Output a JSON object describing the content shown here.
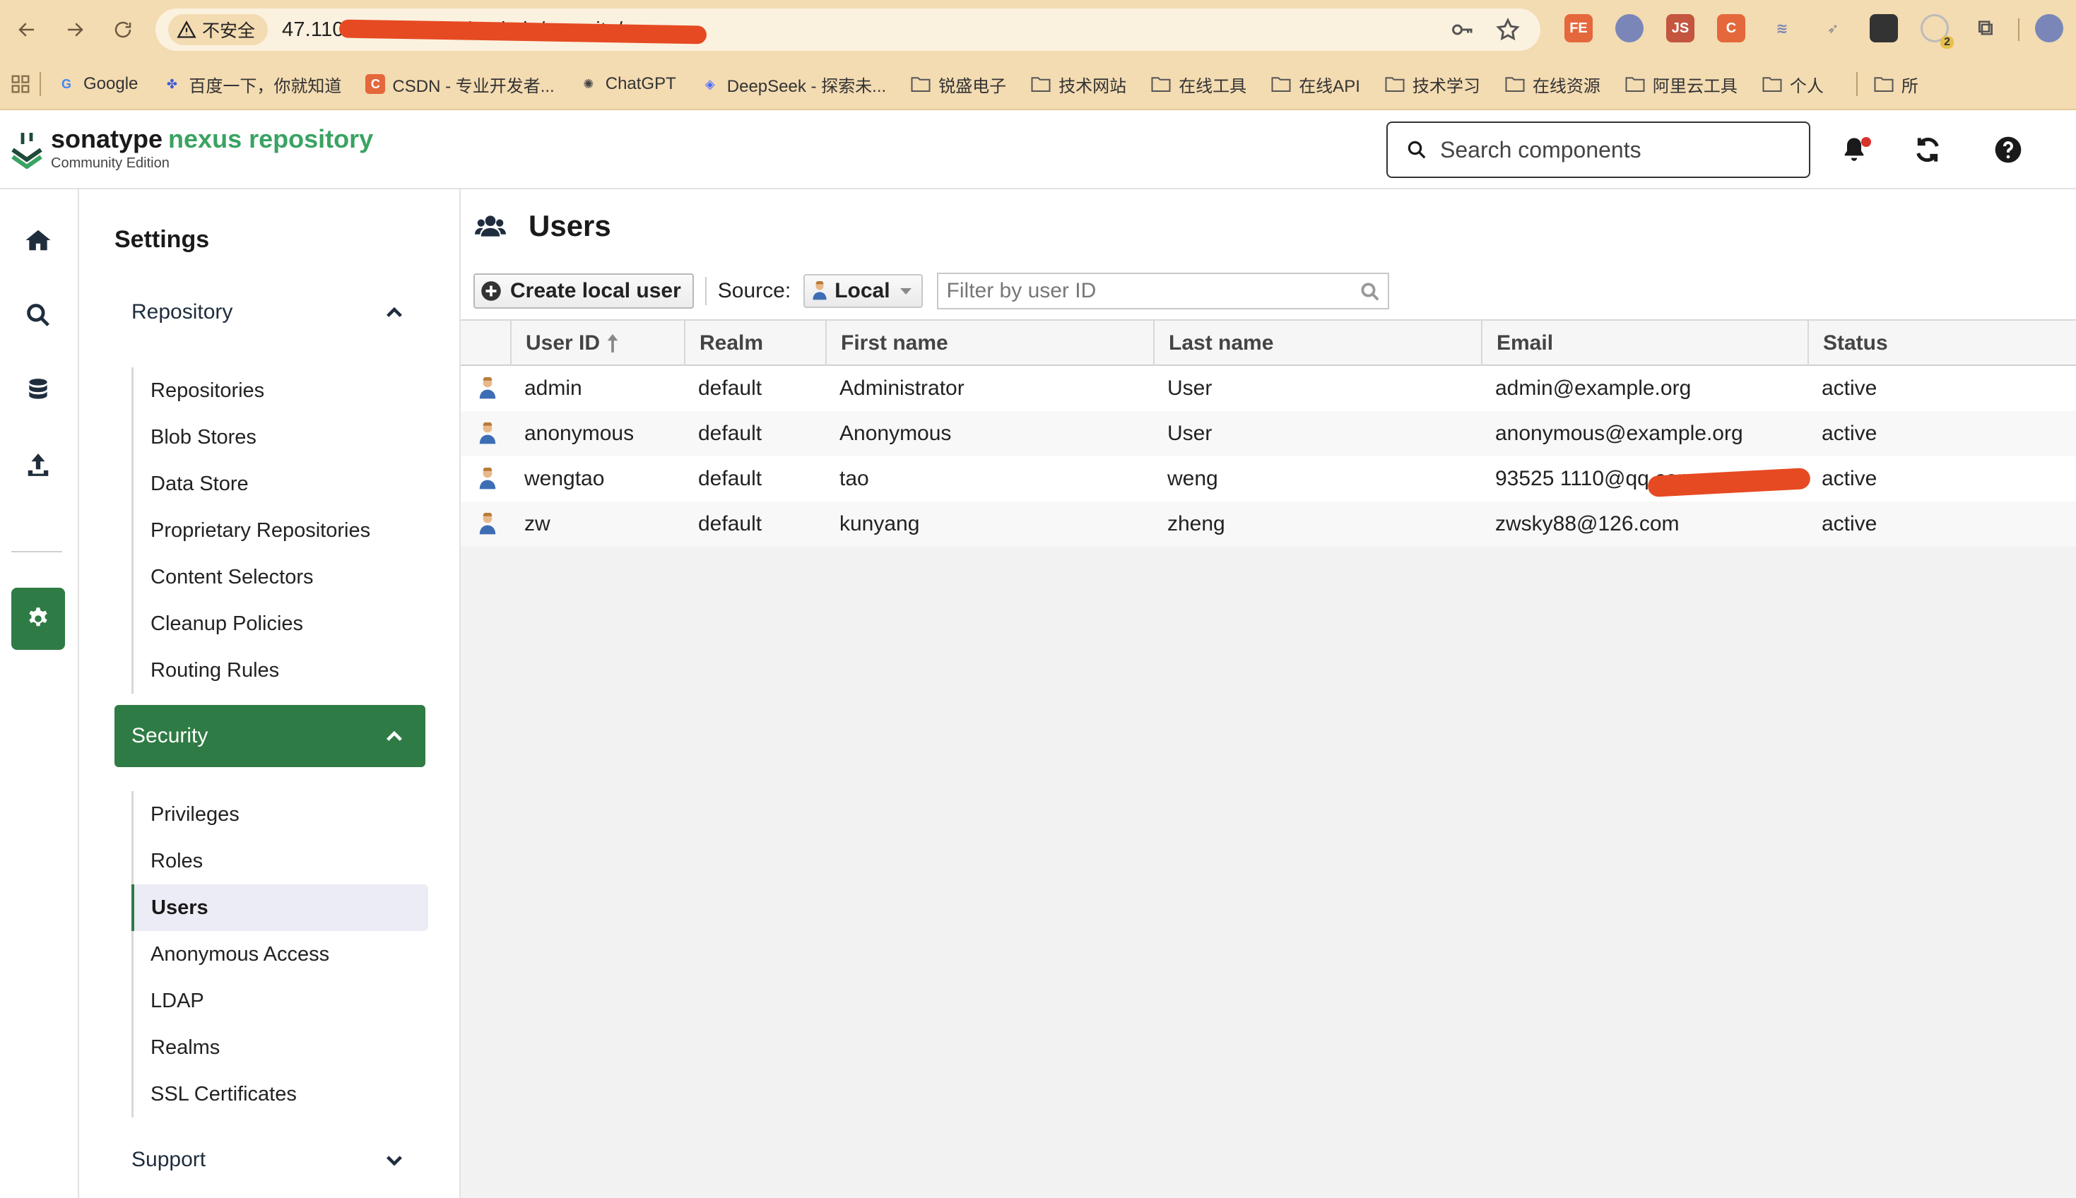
{
  "browser": {
    "insecure_label": "不安全",
    "url": "47.110.147.78:8081/#admin/security/users",
    "bookmarks": [
      {
        "label": "Google",
        "icon": "google-icon"
      },
      {
        "label": "百度一下，你就知道",
        "icon": "baidu-icon"
      },
      {
        "label": "CSDN - 专业开发者...",
        "icon": "csdn-icon"
      },
      {
        "label": "ChatGPT",
        "icon": "chatgpt-icon"
      },
      {
        "label": "DeepSeek - 探索未...",
        "icon": "deepseek-icon"
      },
      {
        "label": "锐盛电子",
        "icon": "folder-icon"
      },
      {
        "label": "技术网站",
        "icon": "folder-icon"
      },
      {
        "label": "在线工具",
        "icon": "folder-icon"
      },
      {
        "label": "在线API",
        "icon": "folder-icon"
      },
      {
        "label": "技术学习",
        "icon": "folder-icon"
      },
      {
        "label": "在线资源",
        "icon": "folder-icon"
      },
      {
        "label": "阿里云工具",
        "icon": "folder-icon"
      },
      {
        "label": "个人",
        "icon": "folder-icon"
      }
    ],
    "bookmarks_overflow": "所",
    "extension_badge": "2"
  },
  "header": {
    "brand_sonatype": "sonatype",
    "brand_nexus": "nexus repository",
    "brand_edition": "Community Edition",
    "search_placeholder": "Search components"
  },
  "sidebar": {
    "title": "Settings",
    "repository": {
      "label": "Repository",
      "items": [
        "Repositories",
        "Blob Stores",
        "Data Store",
        "Proprietary Repositories",
        "Content Selectors",
        "Cleanup Policies",
        "Routing Rules"
      ]
    },
    "security": {
      "label": "Security",
      "items": [
        "Privileges",
        "Roles",
        "Users",
        "Anonymous Access",
        "LDAP",
        "Realms",
        "SSL Certificates"
      ]
    },
    "support": {
      "label": "Support"
    }
  },
  "main": {
    "title": "Users",
    "create_button": "Create local user",
    "source_label": "Source:",
    "source_value": "Local",
    "filter_placeholder": "Filter by user ID",
    "columns": [
      "User ID",
      "Realm",
      "First name",
      "Last name",
      "Email",
      "Status"
    ],
    "rows": [
      {
        "user_id": "admin",
        "realm": "default",
        "first_name": "Administrator",
        "last_name": "User",
        "email": "admin@example.org",
        "status": "active"
      },
      {
        "user_id": "anonymous",
        "realm": "default",
        "first_name": "Anonymous",
        "last_name": "User",
        "email": "anonymous@example.org",
        "status": "active"
      },
      {
        "user_id": "wengtao",
        "realm": "default",
        "first_name": "tao",
        "last_name": "weng",
        "email": "93525 1110@qq.com",
        "status": "active"
      },
      {
        "user_id": "zw",
        "realm": "default",
        "first_name": "kunyang",
        "last_name": "zheng",
        "email": "zwsky88@126.com",
        "status": "active"
      }
    ]
  },
  "colors": {
    "brand_green": "#2f7b45",
    "nexus_green": "#3aa362",
    "browser_chrome": "#f3dbb2",
    "redaction": "#e64a22"
  }
}
